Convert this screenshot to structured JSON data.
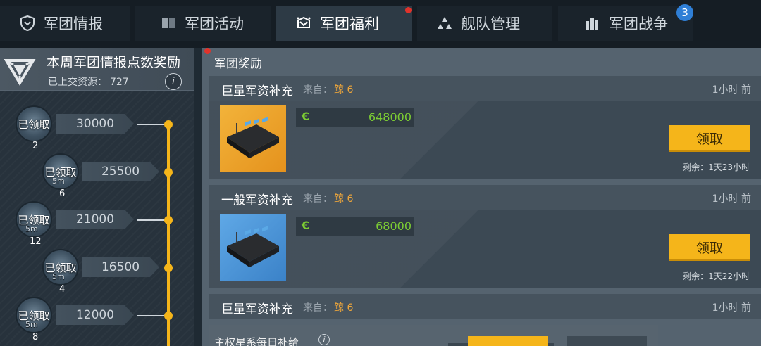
{
  "tabs": [
    {
      "label": "军团情报",
      "icon": "shield-icon"
    },
    {
      "label": "军团活动",
      "icon": "book-icon"
    },
    {
      "label": "军团福利",
      "icon": "gift-icon",
      "active": true
    },
    {
      "label": "舰队管理",
      "icon": "fleet-icon"
    },
    {
      "label": "军团战争",
      "icon": "city-icon",
      "badge": "3"
    }
  ],
  "left_panel": {
    "title": "本周军团情报点数奖励",
    "submitted_label": "已上交资源：",
    "submitted_value": "727",
    "milestones": [
      {
        "points": "30000",
        "status": "已领取",
        "count": "2",
        "time": ""
      },
      {
        "points": "25500",
        "status": "已领取",
        "count": "6",
        "time": "5m"
      },
      {
        "points": "21000",
        "status": "已领取",
        "count": "12",
        "time": "5m"
      },
      {
        "points": "16500",
        "status": "已领取",
        "count": "4",
        "time": "5m"
      },
      {
        "points": "12000",
        "status": "已领取",
        "count": "8",
        "time": "5m"
      }
    ]
  },
  "rewards": {
    "title": "军团奖励",
    "cards": [
      {
        "name": "巨量军资补充",
        "from_label": "来自：",
        "from_name": "鲸 6",
        "time": "1小时 前",
        "currency": "€",
        "amount": "648000",
        "button": "领取",
        "remaining": "剩余：1天23小时"
      },
      {
        "name": "一般军资补充",
        "from_label": "来自：",
        "from_name": "鲸 6",
        "time": "1小时 前",
        "currency": "€",
        "amount": "68000",
        "button": "领取",
        "remaining": "剩余：1天22小时"
      },
      {
        "name": "巨量军资补充",
        "from_label": "来自：",
        "from_name": "鲸 6",
        "time": "1小时 前"
      }
    ],
    "daily": {
      "name": "主权星系每日补给"
    }
  },
  "colors": {
    "accent": "#f5b51a",
    "currency": "#7ccc33",
    "sender": "#f0a73a",
    "badge": "#2f7fd6"
  }
}
